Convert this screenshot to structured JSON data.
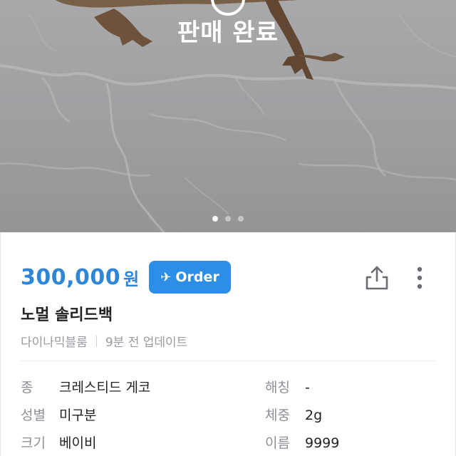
{
  "photo": {
    "sold_label": "판매 완료",
    "carousel": {
      "count": 3,
      "active": 0
    }
  },
  "listing": {
    "price": "300,000",
    "currency": "원",
    "order_label": "Order",
    "title": "노멀 솔리드백",
    "seller": "다이나믹블룸",
    "updated": "9분 전 업데이트"
  },
  "specs": {
    "left": [
      {
        "key": "종",
        "value": "크레스티드 게코"
      },
      {
        "key": "성별",
        "value": "미구분"
      },
      {
        "key": "크기",
        "value": "베이비"
      }
    ],
    "right": [
      {
        "key": "해칭",
        "value": "-"
      },
      {
        "key": "체중",
        "value": "2g"
      },
      {
        "key": "이름",
        "value": "9999"
      }
    ]
  },
  "icons": {
    "share": "share-icon",
    "more": "more-vertical-icon",
    "order": "airplane-icon"
  },
  "colors": {
    "accent": "#2f86d6",
    "button": "#2d8ee8"
  }
}
